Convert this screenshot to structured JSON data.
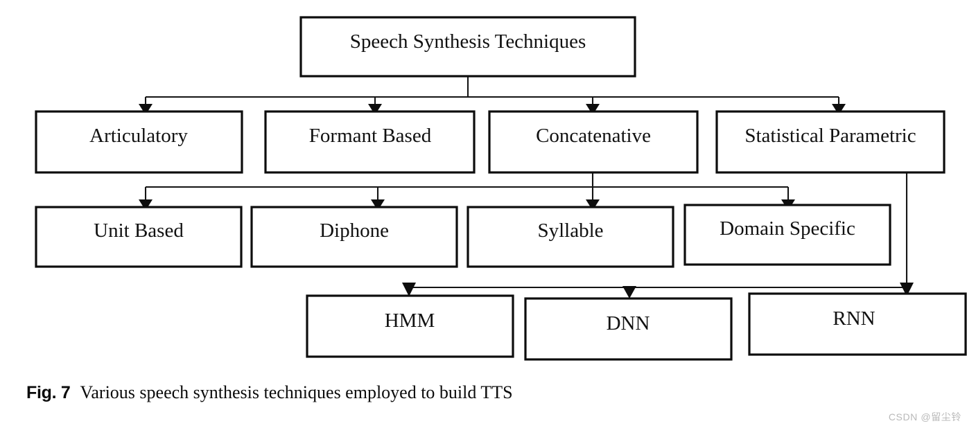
{
  "figure": {
    "caption_tag": "Fig. 7",
    "caption_text": "Various speech synthesis techniques employed to build TTS",
    "watermark": "CSDN @留尘铃",
    "colors": {
      "box_border": "#0d0d0d",
      "box_fill": "#ffffff",
      "connector": "#141414",
      "text": "#111111",
      "background": "#ffffff",
      "watermark": "#b9b9b9"
    }
  },
  "diagram": {
    "type": "tree",
    "root": "Speech Synthesis Techniques",
    "levels": [
      {
        "level": 0,
        "nodes": [
          {
            "id": "root",
            "label": "Speech Synthesis Techniques"
          }
        ]
      },
      {
        "level": 1,
        "nodes": [
          {
            "id": "articulatory",
            "label": "Articulatory"
          },
          {
            "id": "formant",
            "label": "Formant Based"
          },
          {
            "id": "concatenative",
            "label": "Concatenative"
          },
          {
            "id": "statistical",
            "label": "Statistical Parametric"
          }
        ]
      },
      {
        "level": 2,
        "nodes": [
          {
            "id": "unit",
            "label": "Unit Based"
          },
          {
            "id": "diphone",
            "label": "Diphone"
          },
          {
            "id": "syllable",
            "label": "Syllable"
          },
          {
            "id": "domain",
            "label": "Domain Specific"
          }
        ]
      },
      {
        "level": 3,
        "nodes": [
          {
            "id": "hmm",
            "label": "HMM"
          },
          {
            "id": "dnn",
            "label": "DNN"
          },
          {
            "id": "rnn",
            "label": "RNN"
          }
        ]
      }
    ],
    "edges": [
      {
        "from": "root",
        "to": "articulatory"
      },
      {
        "from": "root",
        "to": "formant"
      },
      {
        "from": "root",
        "to": "concatenative"
      },
      {
        "from": "root",
        "to": "statistical"
      },
      {
        "from": "concatenative",
        "to": "unit"
      },
      {
        "from": "concatenative",
        "to": "diphone"
      },
      {
        "from": "concatenative",
        "to": "syllable"
      },
      {
        "from": "concatenative",
        "to": "domain"
      },
      {
        "from": "statistical",
        "to": "hmm"
      },
      {
        "from": "statistical",
        "to": "dnn"
      },
      {
        "from": "statistical",
        "to": "rnn"
      }
    ]
  }
}
